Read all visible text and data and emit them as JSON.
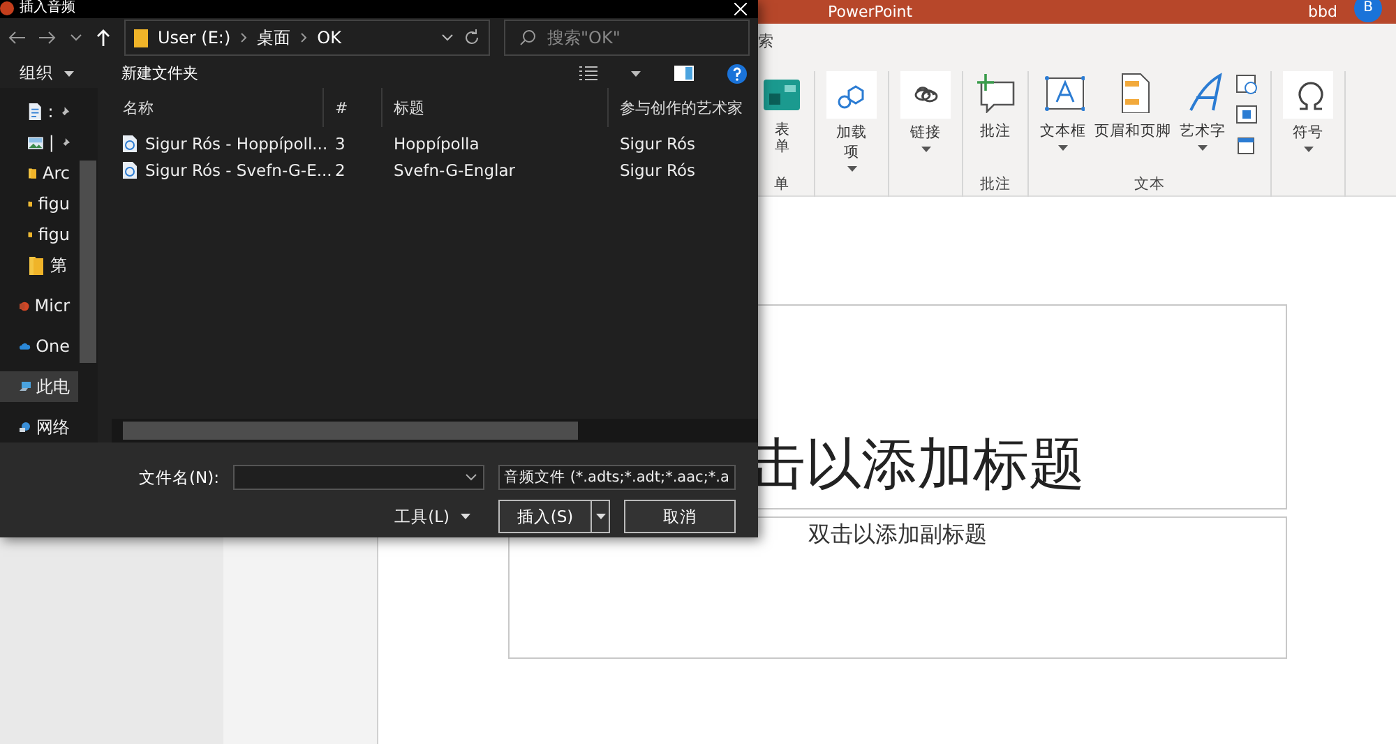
{
  "powerpoint": {
    "title": "PowerPoint",
    "user": "bbd",
    "avatar": "B",
    "tab_fragment": "索",
    "ribbon_groups": [
      {
        "label": "单",
        "buttons": [
          {
            "kind": "large",
            "label": "表单",
            "dropdown": false
          }
        ]
      },
      {
        "buttons": [
          {
            "kind": "boxed",
            "label": "加载项",
            "dropdown": true
          }
        ]
      },
      {
        "buttons": [
          {
            "kind": "boxed",
            "label": "链接",
            "dropdown": true
          }
        ]
      },
      {
        "label": "批注",
        "buttons": [
          {
            "kind": "large",
            "label": "批注",
            "dropdown": false
          }
        ]
      },
      {
        "label": "文本",
        "buttons": [
          {
            "kind": "large",
            "label": "文本框",
            "dropdown": true
          },
          {
            "kind": "large",
            "label": "页眉和页脚",
            "dropdown": false
          },
          {
            "kind": "large",
            "label": "艺术字",
            "dropdown": true
          },
          {
            "kind": "small"
          },
          {
            "kind": "small"
          },
          {
            "kind": "small"
          }
        ]
      },
      {
        "buttons": [
          {
            "kind": "boxed",
            "label": "符号",
            "dropdown": true
          }
        ]
      }
    ]
  },
  "slide": {
    "title": "击以添加标题",
    "subtitle": "双击以添加副标题"
  },
  "dialog": {
    "title": "插入音频",
    "path": [
      "User (E:)",
      "桌面",
      "OK"
    ],
    "search_placeholder": "搜索\"OK\"",
    "organize": "组织",
    "new_folder": "新建文件夹",
    "nav": [
      {
        "kind": "doc",
        "label": ":",
        "pinned": true,
        "selected": false
      },
      {
        "kind": "image",
        "label": "|",
        "pinned": true,
        "selected": false
      },
      {
        "kind": "folder",
        "label": "Arc",
        "pinned": false,
        "selected": false
      },
      {
        "kind": "folder",
        "label": "figu",
        "pinned": false,
        "selected": false
      },
      {
        "kind": "folder",
        "label": "figu",
        "pinned": false,
        "selected": false
      },
      {
        "kind": "folder",
        "label": "第",
        "pinned": false,
        "selected": false
      },
      {
        "kind": "ppt",
        "label": "Micr",
        "pinned": false,
        "selected": false
      },
      {
        "kind": "cloud",
        "label": "One",
        "pinned": false,
        "selected": false
      },
      {
        "kind": "pc",
        "label": "此电",
        "pinned": false,
        "selected": true
      },
      {
        "kind": "network",
        "label": "网络",
        "pinned": false,
        "selected": false
      }
    ],
    "columns": [
      "名称",
      "#",
      "标题",
      "参与创作的艺术家"
    ],
    "rows": [
      {
        "cells": [
          "Sigur Rós - Hoppípoll...",
          "3",
          "Hoppípolla",
          "Sigur Rós"
        ]
      },
      {
        "cells": [
          "Sigur Rós - Svefn-G-E...",
          "2",
          "Svefn-G-Englar",
          "Sigur Rós"
        ]
      }
    ],
    "filename_label": "文件名(N):",
    "filter": "音频文件 (*.adts;*.adt;*.aac;*.a",
    "tools": "工具(L)",
    "insert": "插入(S)",
    "cancel": "取消"
  }
}
